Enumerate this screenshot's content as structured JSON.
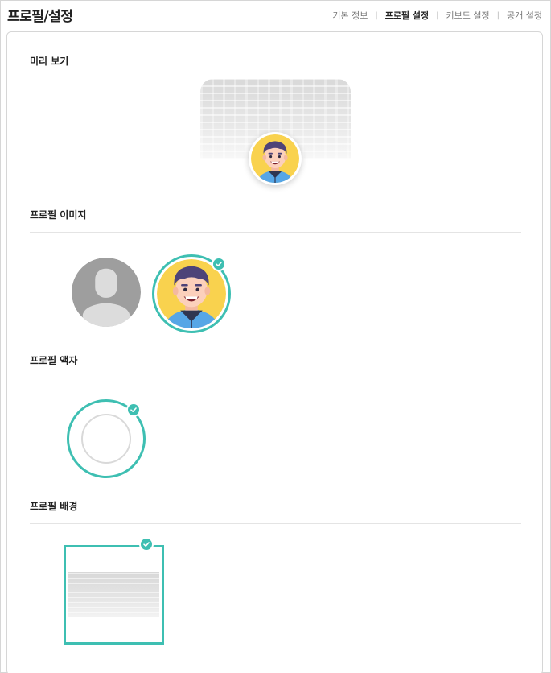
{
  "header": {
    "title": "프로필/설정",
    "tabs": [
      {
        "label": "기본 정보",
        "active": false
      },
      {
        "label": "프로필 설정",
        "active": true
      },
      {
        "label": "키보드 설정",
        "active": false
      },
      {
        "label": "공개 설정",
        "active": false
      }
    ]
  },
  "sections": {
    "preview": {
      "title": "미리 보기"
    },
    "profile_image": {
      "title": "프로필 이미지",
      "selected": "avatar"
    },
    "profile_frame": {
      "title": "프로필 액자",
      "selected": "frame-1"
    },
    "profile_background": {
      "title": "프로필 배경",
      "selected": "background-1"
    }
  },
  "colors": {
    "accent": "#3ebfb2",
    "avatar_bg": "#f9d24e",
    "hair": "#4e4378",
    "hoodie": "#56a6e6",
    "default_avatar": "#9e9e9e"
  },
  "icons": [
    "check-icon",
    "user-placeholder-icon",
    "boy-avatar-icon"
  ]
}
